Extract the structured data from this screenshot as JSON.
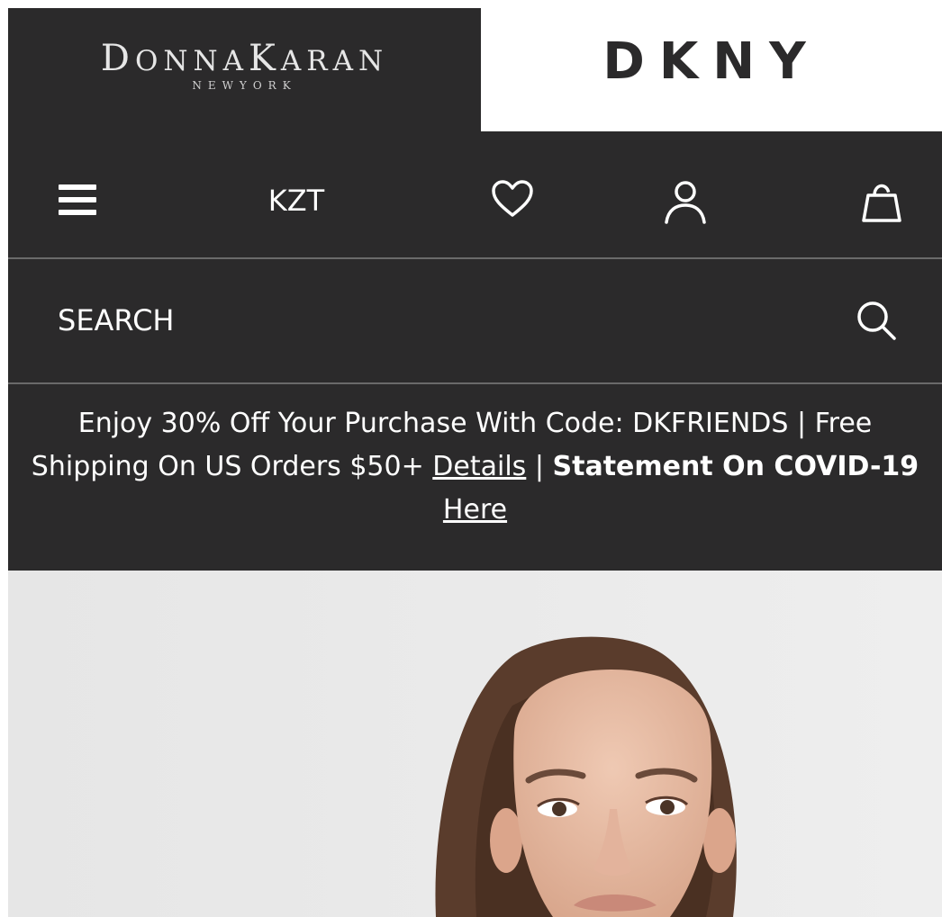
{
  "brands": {
    "donna_karan": {
      "name_D": "D",
      "name_onna": "ONNA",
      "name_K": "K",
      "name_aran": "ARAN",
      "subtitle": "NEWYORK"
    },
    "dkny": {
      "name": "DKNY"
    }
  },
  "nav": {
    "currency": "KZT",
    "icons": [
      "hamburger-menu-icon",
      "heart-icon",
      "user-icon",
      "shopping-bag-icon"
    ]
  },
  "search": {
    "placeholder": "SEARCH",
    "icon": "search-icon"
  },
  "promo": {
    "line_part1": "Enjoy 30% Off Your Purchase With Code: DKFRIENDS | Free Shipping On US Orders $50+",
    "details_link": "Details",
    "separator": "|",
    "covid_bold": "Statement On COVID-19",
    "here_link": "Here"
  },
  "colors": {
    "header_bg": "#2b2a2b",
    "text_light": "#ffffff",
    "divider": "#6a6a6a",
    "hero_bg": "#e9e9e9"
  }
}
